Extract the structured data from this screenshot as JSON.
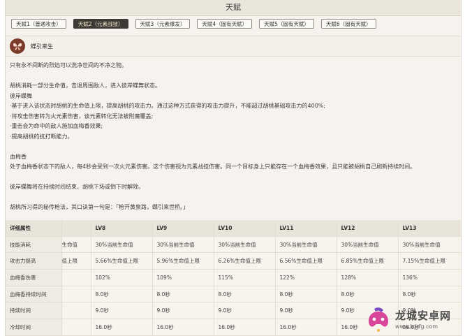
{
  "header": {
    "title": "天赋"
  },
  "tabs": [
    {
      "label": "天赋1（普通攻击）",
      "active": false
    },
    {
      "label": "天赋2（元素战技）",
      "active": true
    },
    {
      "label": "天赋3（元素爆发）",
      "active": false
    },
    {
      "label": "天赋4（固有天赋）",
      "active": false
    },
    {
      "label": "天赋5（固有天赋）",
      "active": false
    },
    {
      "label": "天赋6（固有天赋）",
      "active": false
    }
  ],
  "skill": {
    "icon": "butterfly-icon",
    "name": "蝶引来生"
  },
  "description": {
    "line1": "只有永不间断的烈焰可以洗净世间的不净之物。",
    "line2": "胡桃消耗一部分生命值，击退周围敌人，进入彼岸蝶舞状态。",
    "line3": "彼岸蝶舞",
    "line4": "·基于进入该状态时胡桃的生命值上限，提高胡桃的攻击力。通过这种方式获得的攻击力提升，不能超过胡桃基础攻击力的400%;",
    "line5": "·将攻击伤害转为火元素伤害，该元素转化无法被附魔覆盖;",
    "line6": "·重击会为命中的敌人施加血梅香效果;",
    "line7": "·提高胡桃的抗打断能力。",
    "line8": "血梅香",
    "line9": "处于血梅香状态下的敌人，每4秒会受到一次火元素伤害。这个伤害视为元素战技伤害。同一个目标身上只能存在一个血梅香效果，且只能被胡桃自己刷新持续时间。",
    "line10": "彼岸蝶舞将在持续时间结束、胡桃下场或倒下时解除。",
    "line11": "胡桃所习得的秘传枪法，其口诀第一句是：「枪开黄泉路，蝶引来世桥。」"
  },
  "table": {
    "headers": [
      "详细属性",
      "",
      "LV8",
      "LV9",
      "LV10",
      "LV11",
      "LV12",
      "LV13"
    ],
    "rows": [
      [
        "技能消耗",
        "生命值",
        "30%当前生命值",
        "30%当前生命值",
        "30%当前生命值",
        "30%当前生命值",
        "30%当前生命值",
        "30%当前生命值"
      ],
      [
        "攻击力提高",
        "值上限",
        "5.66%生命值上限",
        "5.96%生命值上限",
        "6.26%生命值上限",
        "6.56%生命值上限",
        "6.85%生命值上限",
        "7.15%生命值上限"
      ],
      [
        "血梅香伤害",
        "",
        "102%",
        "109%",
        "115%",
        "122%",
        "128%",
        "136%"
      ],
      [
        "血梅香持续时间",
        "",
        "8.0秒",
        "8.0秒",
        "8.0秒",
        "8.0秒",
        "8.0秒",
        "8.0秒"
      ],
      [
        "持续时间",
        "",
        "9.0秒",
        "9.0秒",
        "9.0秒",
        "9.0秒",
        "9.0秒",
        "9.0秒"
      ],
      [
        "冷却时间",
        "",
        "16.0秒",
        "16.0秒",
        "16.0秒",
        "16.0秒",
        "16.0秒",
        "16.0秒"
      ]
    ]
  },
  "watermark": {
    "name": "龙城安卓网",
    "url": "www.lcjrfg.com",
    "logo_icon": "game-controller-logo-icon"
  },
  "colors": {
    "active_tab": "#3d3a36",
    "active_tab_text": "#f1e6c9",
    "header_bg": "#ebe6dc",
    "panel_bg": "#f6f3ee",
    "logo_pink": "#d9479a",
    "logo_purple": "#7b4bc4"
  }
}
